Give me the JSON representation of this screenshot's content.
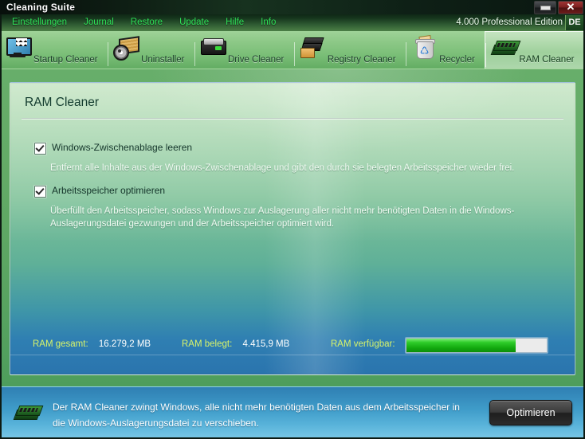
{
  "window": {
    "title": "Cleaning Suite",
    "minimize_label": "–",
    "close_label": "✕"
  },
  "menu": {
    "items": [
      {
        "label": "Einstellungen"
      },
      {
        "label": "Journal"
      },
      {
        "label": "Restore"
      },
      {
        "label": "Update"
      },
      {
        "label": "Hilfe"
      },
      {
        "label": "Info"
      }
    ],
    "edition": "4.000 Professional Edition",
    "language": "DE"
  },
  "toolbar": {
    "tabs": [
      {
        "label": "Startup Cleaner",
        "icon": "monitor-icon",
        "active": false
      },
      {
        "label": "Uninstaller",
        "icon": "uninstaller-icon",
        "active": false
      },
      {
        "label": "Drive Cleaner",
        "icon": "harddrive-icon",
        "active": false
      },
      {
        "label": "Registry Cleaner",
        "icon": "registry-icon",
        "active": false
      },
      {
        "label": "Recycler",
        "icon": "recyclebin-icon",
        "active": false
      },
      {
        "label": "RAM Cleaner",
        "icon": "ram-icon",
        "active": true
      }
    ]
  },
  "panel": {
    "title": "RAM Cleaner",
    "options": [
      {
        "label": "Windows-Zwischenablage leeren",
        "checked": true,
        "description": "Entfernt alle Inhalte aus der Windows-Zwischenablage und gibt den durch sie belegten Arbeitsspeicher wieder frei."
      },
      {
        "label": "Arbeitsspeicher optimieren",
        "checked": true,
        "description": "Überfüllt den Arbeitsspeicher, sodass Windows zur Auslagerung aller nicht mehr benötigten Daten in die Windows-Auslagerungsdatei gezwungen und der Arbeitsspeicher optimiert wird."
      }
    ],
    "status": {
      "total_label": "RAM gesamt:",
      "total_value": "16.279,2 MB",
      "used_label": "RAM belegt:",
      "used_value": "4.415,9 MB",
      "available_label": "RAM verfügbar:",
      "available_percent": 78
    }
  },
  "footer": {
    "icon": "ram-icon",
    "message": "Der RAM Cleaner zwingt Windows, alle nicht mehr benötigten Daten aus dem Arbeitsspeicher in die Windows-Auslagerungsdatei zu verschieben.",
    "button_label": "Optimieren"
  },
  "colors": {
    "menu_text": "#2fe058",
    "status_key": "#d7f36a",
    "progress_fill": "#12a80f",
    "footer_bg": "#3f9cc9"
  }
}
